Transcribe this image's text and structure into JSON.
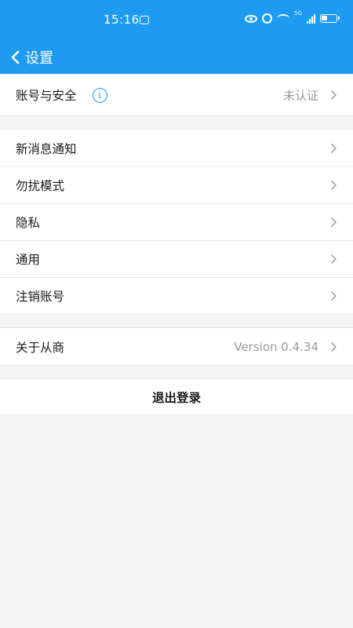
{
  "status_bar": {
    "time": "15:16",
    "network": "5G"
  },
  "nav": {
    "title": "设置"
  },
  "groups": [
    {
      "items": [
        {
          "label": "账号与安全",
          "value": "未认证",
          "has_info": true
        }
      ]
    },
    {
      "items": [
        {
          "label": "新消息通知"
        },
        {
          "label": "勿扰模式"
        },
        {
          "label": "隐私"
        },
        {
          "label": "通用"
        },
        {
          "label": "注销账号"
        }
      ]
    },
    {
      "items": [
        {
          "label": "关于从商",
          "value": "Version 0.4.34"
        }
      ]
    }
  ],
  "logout": {
    "label": "退出登录"
  },
  "colors": {
    "accent": "#1e9bf0",
    "background": "#f5f5f5",
    "secondary_text": "#9a9a9a"
  }
}
